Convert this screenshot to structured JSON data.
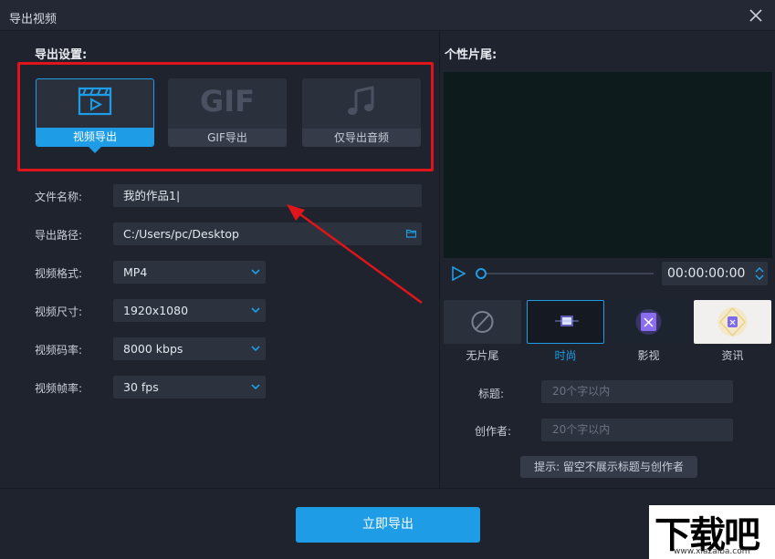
{
  "window": {
    "title": "导出视频"
  },
  "export_settings": {
    "heading": "导出设置:",
    "modes": [
      {
        "label": "视频导出",
        "icon": "clapperboard-icon",
        "active": true
      },
      {
        "label": "GIF导出",
        "icon_text": "GIF",
        "active": false
      },
      {
        "label": "仅导出音频",
        "icon": "music-note-icon",
        "active": false
      }
    ]
  },
  "fields": {
    "filename": {
      "label": "文件名称:",
      "value": "我的作品1"
    },
    "path": {
      "label": "导出路径:",
      "value": "C:/Users/pc/Desktop"
    },
    "format": {
      "label": "视频格式:",
      "value": "MP4"
    },
    "size": {
      "label": "视频尺寸:",
      "value": "1920x1080"
    },
    "bitrate": {
      "label": "视频码率:",
      "value": "8000 kbps"
    },
    "framerate": {
      "label": "视频帧率:",
      "value": "30 fps"
    }
  },
  "outro": {
    "heading": "个性片尾:",
    "time": "00:00:00:00",
    "templates": [
      {
        "label": "无片尾",
        "active": false
      },
      {
        "label": "时尚",
        "active": true
      },
      {
        "label": "影视",
        "active": false
      },
      {
        "label": "资讯",
        "active": false
      }
    ],
    "title_label": "标题:",
    "title_placeholder": "20个字以内",
    "author_label": "创作者:",
    "author_placeholder": "20个字以内",
    "hint": "提示: 留空不展示标题与创作者"
  },
  "footer": {
    "export_label": "立即导出"
  },
  "watermark": {
    "main": "下载吧",
    "sub": "www.xiazaiba.com"
  },
  "colors": {
    "accent": "#1e9de6",
    "highlight_box": "#e0141b",
    "background": "#1e232d"
  }
}
